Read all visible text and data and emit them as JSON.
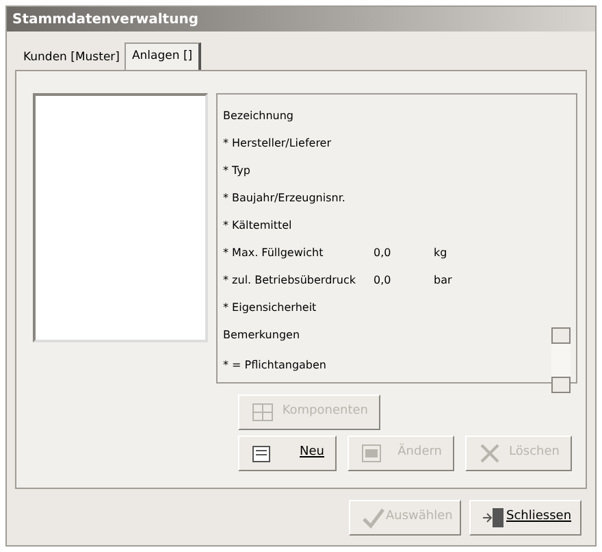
{
  "window": {
    "title": "Stammdatenverwaltung"
  },
  "tabs": [
    {
      "label": "Kunden [Muster]",
      "selected": false
    },
    {
      "label": "Anlagen []",
      "selected": true
    }
  ],
  "fields": [
    {
      "label": "Bezeichnung"
    },
    {
      "label": "* Hersteller/Lieferer"
    },
    {
      "label": "* Typ"
    },
    {
      "label": "* Baujahr/Erzeugnisnr."
    },
    {
      "label": "* Kältemittel"
    },
    {
      "label": "* Max. Füllgewicht",
      "value": "0,0",
      "unit": "kg"
    },
    {
      "label": "* zul. Betriebsüberdruck",
      "value": "0,0",
      "unit": "bar"
    },
    {
      "label": "* Eigensicherheit"
    },
    {
      "label": "Bemerkungen"
    }
  ],
  "note": "* = Pflichtangaben",
  "component_button": {
    "label": "Komponenten",
    "disabled": true
  },
  "action_buttons": [
    {
      "kind": "new",
      "label": "Neu",
      "disabled": false
    },
    {
      "kind": "edit",
      "label": "Ändern",
      "disabled": true
    },
    {
      "kind": "delete",
      "label": "Löschen",
      "disabled": true
    }
  ],
  "footer_buttons": [
    {
      "kind": "select",
      "label": "Auswählen",
      "disabled": true
    },
    {
      "kind": "close",
      "label": "Schliessen",
      "disabled": false
    }
  ]
}
